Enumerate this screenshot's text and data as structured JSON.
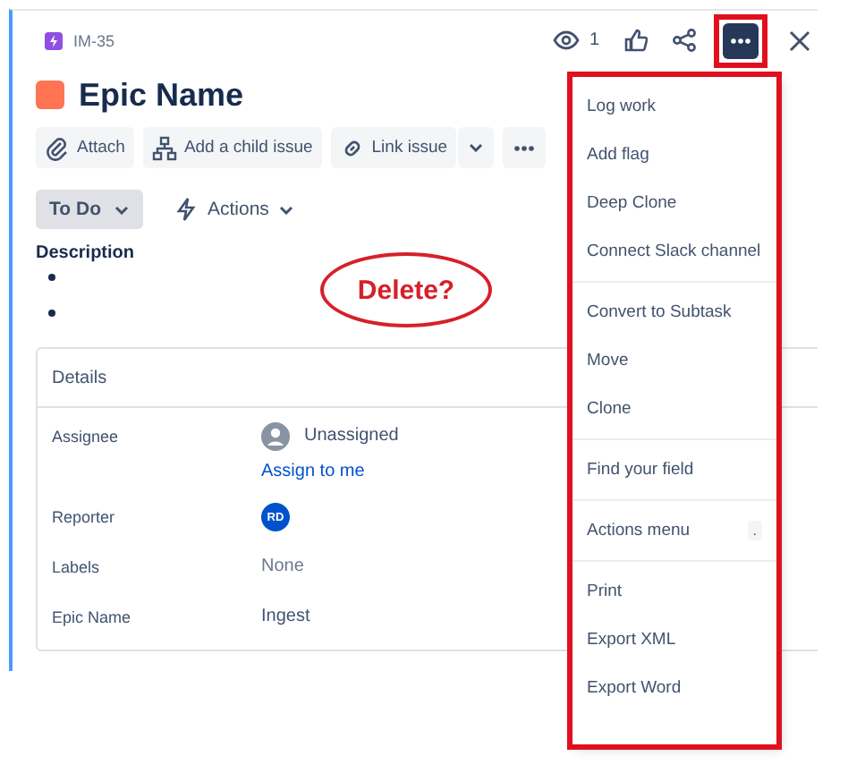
{
  "issue": {
    "key": "IM-35",
    "title": "Epic Name",
    "watchers": "1"
  },
  "toolbar": [
    {
      "kind": "attach",
      "label": "Attach"
    },
    {
      "kind": "child",
      "label": "Add a child issue"
    },
    {
      "kind": "link",
      "label": "Link issue"
    }
  ],
  "status": {
    "label": "To Do"
  },
  "actions": {
    "label": "Actions"
  },
  "more_button": {
    "highlighted": true
  },
  "description": {
    "label": "Description",
    "bullets": [
      {
        "kind": "empty"
      },
      {
        "kind": "empty"
      }
    ]
  },
  "details": {
    "title": "Details",
    "fields": [
      {
        "label": "Assignee",
        "kind": "user",
        "value": "Unassigned",
        "link": "Assign to me"
      },
      {
        "label": "Reporter",
        "kind": "avatar",
        "value": "RD"
      },
      {
        "label": "Labels",
        "kind": "empty",
        "value": "None"
      },
      {
        "label": "Epic Name",
        "kind": "text",
        "value": "Ingest"
      }
    ]
  },
  "menu": {
    "highlighted": true,
    "groups": [
      [
        {
          "label": "Log work"
        },
        {
          "label": "Add flag"
        },
        {
          "label": "Deep Clone"
        },
        {
          "label": "Connect Slack channel"
        }
      ],
      [
        {
          "label": "Convert to Subtask"
        },
        {
          "label": "Move"
        },
        {
          "label": "Clone"
        }
      ],
      [
        {
          "label": "Find your field"
        }
      ],
      [
        {
          "label": "Actions menu",
          "shortcut": "."
        }
      ],
      [
        {
          "label": "Print"
        },
        {
          "label": "Export XML"
        },
        {
          "label": "Export Word"
        }
      ]
    ]
  },
  "annotation": {
    "kind": "ellipse",
    "text": "Delete?"
  }
}
